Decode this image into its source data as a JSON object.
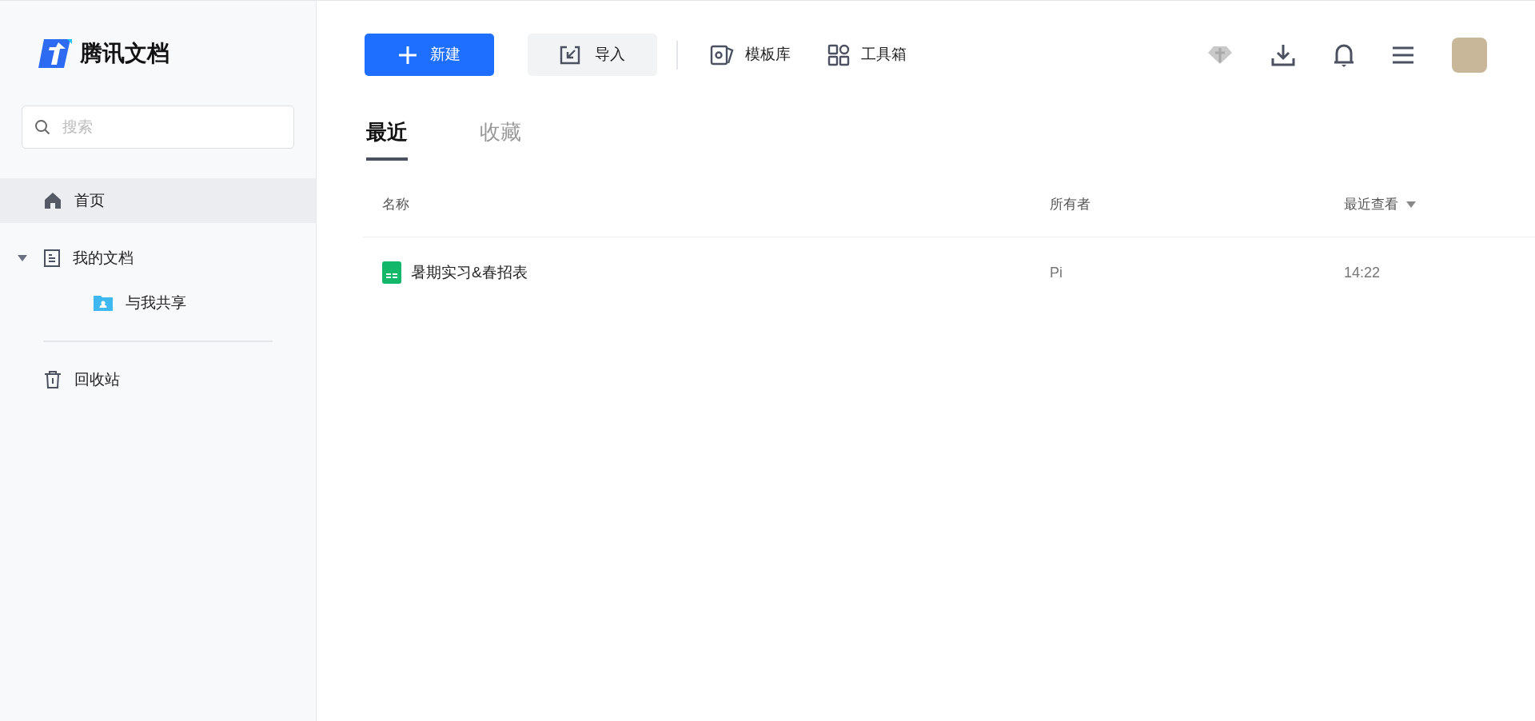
{
  "sidebar": {
    "logo": "腾讯文档",
    "search": {
      "placeholder": "搜索"
    },
    "items": [
      {
        "label": "首页",
        "kind": "home",
        "selected": true
      },
      {
        "label": "我的文档",
        "kind": "docs",
        "selected": false,
        "expanded": true,
        "children": [
          {
            "label": "与我共享",
            "kind": "shared",
            "selected": false
          }
        ]
      },
      {
        "label": "回收站",
        "kind": "trash",
        "selected": false
      }
    ]
  },
  "toolbar": {
    "primary": "新建",
    "import": "导入",
    "links": [
      {
        "label": "模板库",
        "kind": "template"
      },
      {
        "label": "工具箱",
        "kind": "tools"
      }
    ]
  },
  "tabs": [
    {
      "label": "最近",
      "selected": true
    },
    {
      "label": "收藏",
      "selected": false
    }
  ],
  "table": {
    "columns": [
      {
        "label": "名称",
        "sorted": false
      },
      {
        "label": "所有者",
        "sorted": false
      },
      {
        "label": "最近查看",
        "sorted": true
      }
    ],
    "rows": [
      {
        "kind": "sheet",
        "name": "暑期实习&春招表",
        "owner": "Pi",
        "viewed": "14:22"
      }
    ]
  }
}
